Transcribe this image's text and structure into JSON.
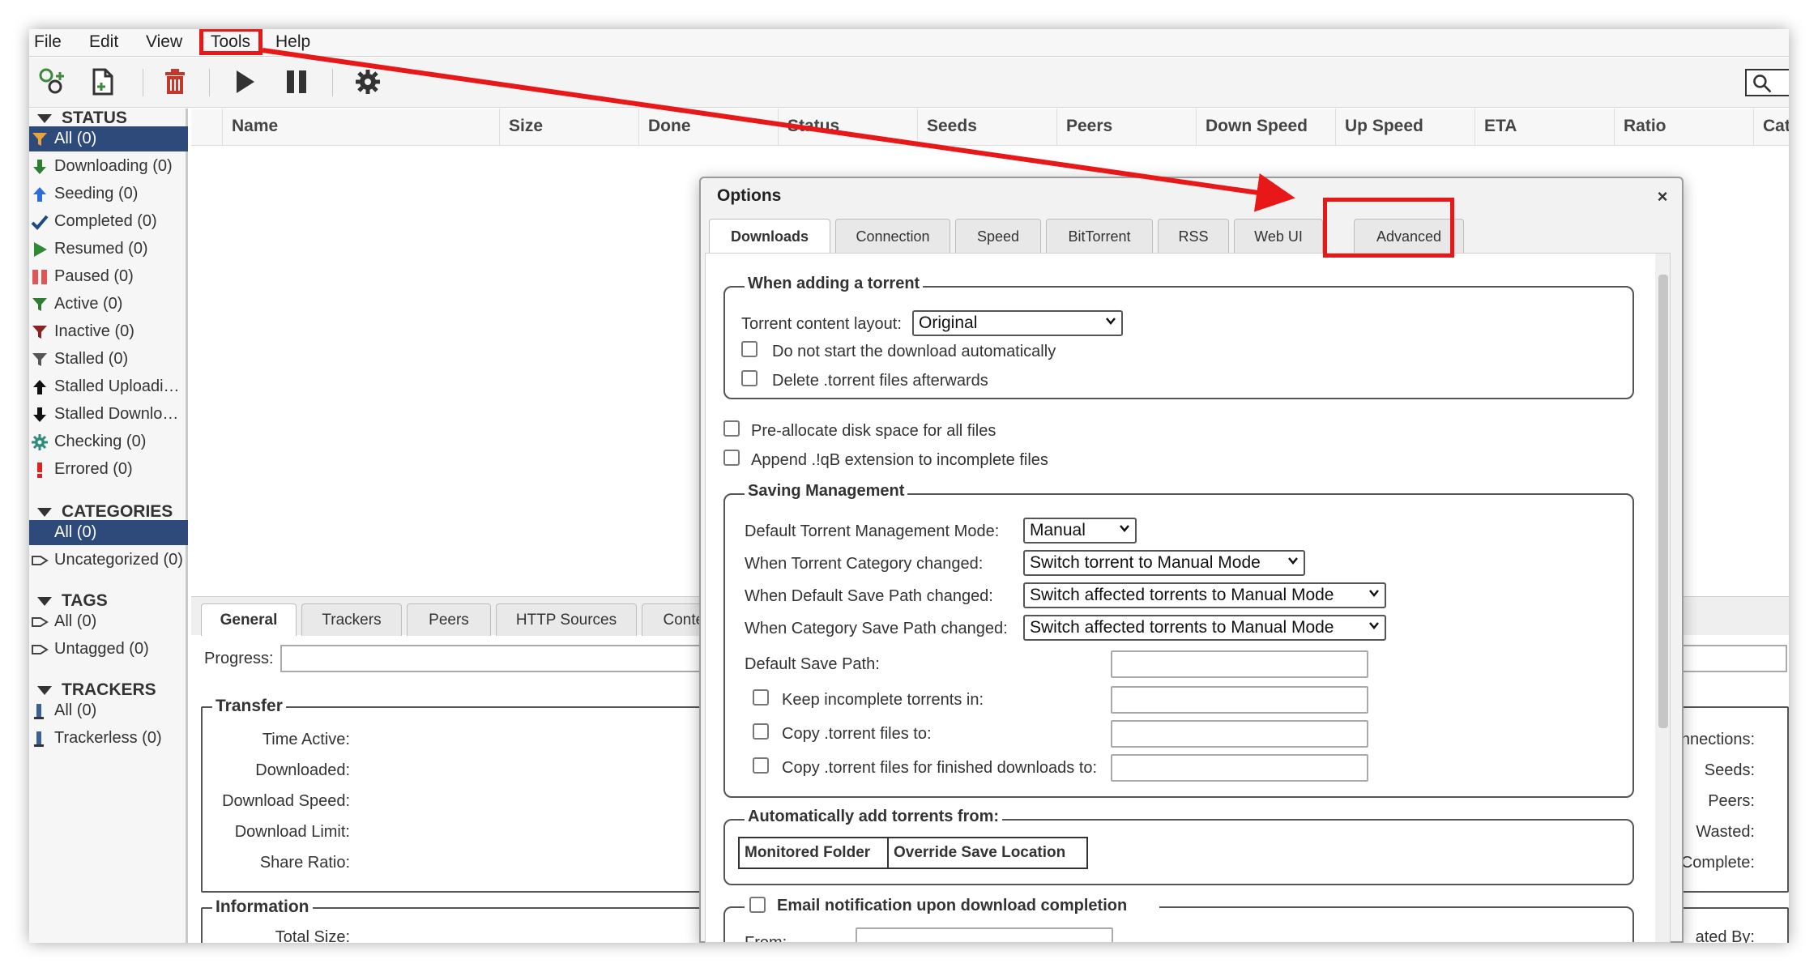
{
  "menu": [
    "File",
    "Edit",
    "View",
    "Tools",
    "Help"
  ],
  "sidebar": {
    "status_header": "STATUS",
    "status_items": [
      {
        "label": "All (0)",
        "icon": "filter-icon",
        "selected": true
      },
      {
        "label": "Downloading (0)",
        "icon": "download-arrow-icon"
      },
      {
        "label": "Seeding (0)",
        "icon": "upload-arrow-icon"
      },
      {
        "label": "Completed (0)",
        "icon": "checkmark-icon"
      },
      {
        "label": "Resumed (0)",
        "icon": "play-icon"
      },
      {
        "label": "Paused (0)",
        "icon": "pause-icon"
      },
      {
        "label": "Active (0)",
        "icon": "filter-icon"
      },
      {
        "label": "Inactive (0)",
        "icon": "filter-icon"
      },
      {
        "label": "Stalled (0)",
        "icon": "filter-icon"
      },
      {
        "label": "Stalled Uploadi…",
        "icon": "upload-arrow-icon"
      },
      {
        "label": "Stalled Downlo…",
        "icon": "download-arrow-icon"
      },
      {
        "label": "Checking (0)",
        "icon": "gear-icon"
      },
      {
        "label": "Errored (0)",
        "icon": "exclamation-icon"
      }
    ],
    "categories_header": "CATEGORIES",
    "category_items": [
      {
        "label": "All (0)",
        "selected": true
      },
      {
        "label": "Uncategorized (0)",
        "icon": "tag-icon"
      }
    ],
    "tags_header": "TAGS",
    "tag_items": [
      {
        "label": "All (0)",
        "icon": "tag-icon"
      },
      {
        "label": "Untagged (0)",
        "icon": "tag-icon"
      }
    ],
    "trackers_header": "TRACKERS",
    "tracker_items": [
      {
        "label": "All (0)",
        "icon": "server-icon"
      },
      {
        "label": "Trackerless (0)",
        "icon": "server-icon"
      }
    ]
  },
  "table": {
    "columns": [
      "Name",
      "Size",
      "Done",
      "Status",
      "Seeds",
      "Peers",
      "Down Speed",
      "Up Speed",
      "ETA",
      "Ratio",
      "Catego"
    ]
  },
  "bottom_panel": {
    "tabs": [
      "General",
      "Trackers",
      "Peers",
      "HTTP Sources",
      "Conter"
    ],
    "progress_label": "Progress:",
    "transfer_legend": "Transfer",
    "transfer_labels": [
      "Time Active:",
      "Downloaded:",
      "Download Speed:",
      "Download Limit:",
      "Share Ratio:"
    ],
    "right_labels": [
      "onnections:",
      "Seeds:",
      "Peers:",
      "Wasted:",
      "n Complete:"
    ],
    "information_legend": "Information",
    "info_labels": [
      "Total Size:"
    ],
    "right_info_labels": [
      "ated By:"
    ]
  },
  "dialog": {
    "title": "Options",
    "close": "×",
    "tabs": [
      "Downloads",
      "Connection",
      "Speed",
      "BitTorrent",
      "RSS",
      "Web UI",
      "Advanced"
    ],
    "when_adding": {
      "legend": "When adding a torrent",
      "layout_label": "Torrent content layout:",
      "layout_value": "Original",
      "do_not_start": "Do not start the download automatically",
      "delete_torrent": "Delete .torrent files afterwards"
    },
    "preallocate": "Pre-allocate disk space for all files",
    "append_ext": "Append .!qB extension to incomplete files",
    "saving": {
      "legend": "Saving Management",
      "mode_label": "Default Torrent Management Mode:",
      "mode_value": "Manual",
      "category_changed_label": "When Torrent Category changed:",
      "category_changed_value": "Switch torrent to Manual Mode",
      "default_path_changed_label": "When Default Save Path changed:",
      "default_path_changed_value": "Switch affected torrents to Manual Mode",
      "category_path_changed_label": "When Category Save Path changed:",
      "category_path_changed_value": "Switch affected torrents to Manual Mode",
      "default_save_path_label": "Default Save Path:",
      "keep_incomplete_label": "Keep incomplete torrents in:",
      "copy_torrent_label": "Copy .torrent files to:",
      "copy_finished_label": "Copy .torrent files for finished downloads to:"
    },
    "auto_add": {
      "legend": "Automatically add torrents from:",
      "col_monitored": "Monitored Folder",
      "col_override": "Override Save Location"
    },
    "email": {
      "legend": "Email notification upon download completion",
      "from_label": "From:"
    }
  },
  "colors": {
    "annotation_red": "#e81818",
    "selection_blue": "#2e4a7a"
  }
}
